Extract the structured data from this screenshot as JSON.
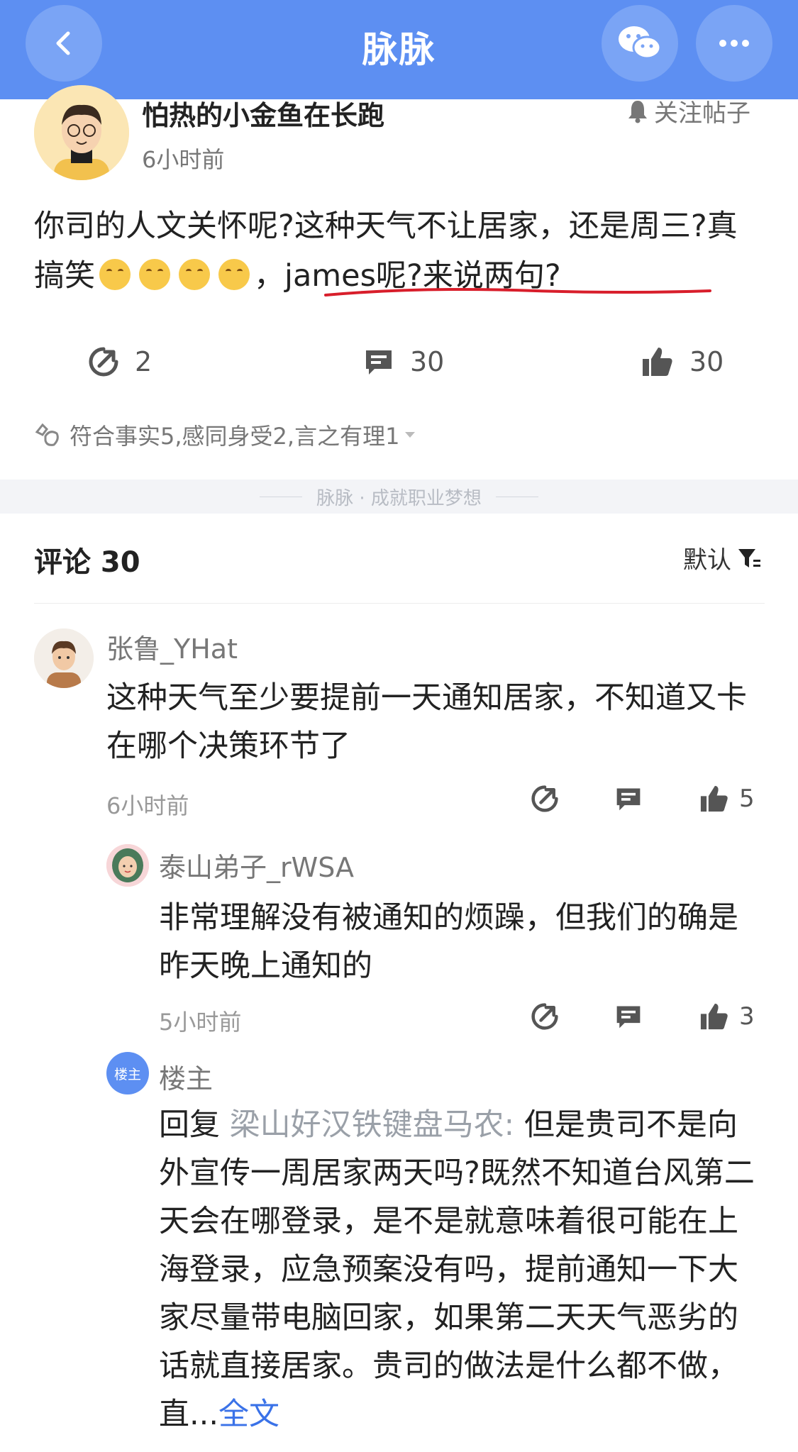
{
  "header": {
    "title": "脉脉",
    "back_icon": "chevron-left-icon",
    "share_icon": "wechat-icon",
    "more_icon": "more-dots-icon"
  },
  "post": {
    "author": "怕热的小金鱼在长跑",
    "time": "6小时前",
    "follow_label": "关注帖子",
    "content_part1": "你司的人文关怀呢?这种天气不让居家，还是周三?真搞笑",
    "content_part2": "，james呢?来说两句?",
    "share_count": "2",
    "comment_count": "30",
    "like_count": "30",
    "reactions_text": "符合事实5,感同身受2,言之有理1"
  },
  "divider_text": "脉脉 · 成就职业梦想",
  "comments_header": "评论 30",
  "sort_label": "默认",
  "comments": [
    {
      "name": "张鲁_YHat",
      "text": "这种天气至少要提前一天通知居家，不知道又卡在哪个决策环节了",
      "time": "6小时前",
      "likes": "5"
    },
    {
      "name": "泰山弟子_rWSA",
      "text": "非常理解没有被通知的烦躁，但我们的确是昨天晚上通知的",
      "time": "5小时前",
      "likes": "3"
    },
    {
      "badge": "楼主",
      "name": "楼主",
      "reply_prefix": "回复 ",
      "reply_to": "梁山好汉铁键盘马农:",
      "text": " 但是贵司不是向外宣传一周居家两天吗?既然不知道台风第二天会在哪登录，是不是就意味着很可能在上海登录，应急预案没有吗，提前通知一下大家尽量带电脑回家，如果第二天天气恶劣的话就直接居家。贵司的做法是什么都不做，直...",
      "full_text_label": "全文"
    }
  ],
  "colors": {
    "brand": "#5d8ff2",
    "underline": "#d81e2b",
    "link": "#3a72e8"
  }
}
